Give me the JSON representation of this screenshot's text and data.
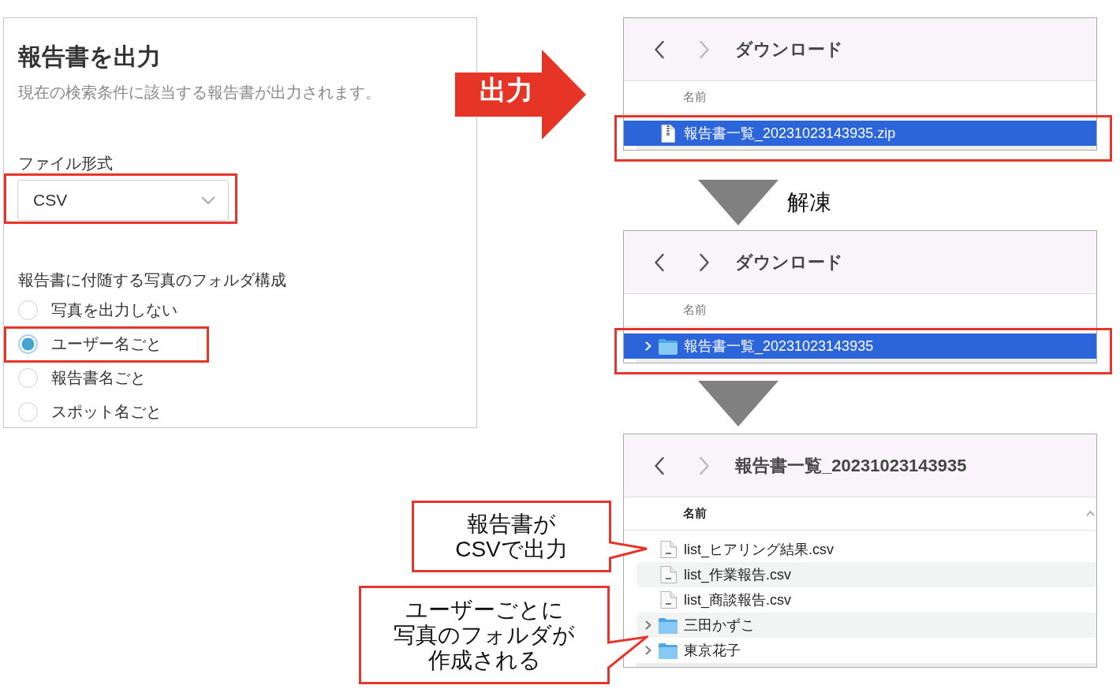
{
  "export_panel": {
    "title": "報告書を出力",
    "description": "現在の検索条件に該当する報告書が出力されます。",
    "file_format": {
      "label": "ファイル形式",
      "value": "CSV",
      "highlighted": true
    },
    "photo_folder": {
      "label": "報告書に付随する写真のフォルダ構成",
      "options": [
        {
          "label": "写真を出力しない",
          "selected": false,
          "highlighted": false
        },
        {
          "label": "ユーザー名ごと",
          "selected": true,
          "highlighted": true
        },
        {
          "label": "報告書名ごと",
          "selected": false,
          "highlighted": false
        },
        {
          "label": "スポット名ごと",
          "selected": false,
          "highlighted": false
        }
      ]
    }
  },
  "export_arrow": {
    "label": "出力"
  },
  "finder_windows": [
    {
      "title": "ダウンロード",
      "back_enabled": true,
      "forward_enabled": false,
      "column_header": "名前",
      "sorted": false,
      "rows": [
        {
          "kind": "zip",
          "name": "報告書一覧_20231023143935.zip",
          "selected": true,
          "highlighted": true
        }
      ]
    },
    {
      "step_label": "解凍",
      "title": "ダウンロード",
      "back_enabled": true,
      "forward_enabled": true,
      "column_header": "名前",
      "sorted": false,
      "rows": [
        {
          "kind": "folder",
          "name": "報告書一覧_20231023143935",
          "selected": true,
          "highlighted": true,
          "expanded": false
        }
      ]
    },
    {
      "title": "報告書一覧_20231023143935",
      "back_enabled": true,
      "forward_enabled": false,
      "column_header": "名前",
      "sorted": true,
      "rows": [
        {
          "kind": "csv",
          "name": "list_ヒアリング結果.csv",
          "selected": false,
          "highlighted": false
        },
        {
          "kind": "csv",
          "name": "list_作業報告.csv",
          "selected": false,
          "highlighted": false
        },
        {
          "kind": "csv",
          "name": "list_商談報告.csv",
          "selected": false,
          "highlighted": false
        },
        {
          "kind": "folder",
          "name": "三田かずこ",
          "selected": false,
          "highlighted": false,
          "expanded": false
        },
        {
          "kind": "folder",
          "name": "東京花子",
          "selected": false,
          "highlighted": false,
          "expanded": false
        }
      ]
    }
  ],
  "callouts": [
    {
      "lines": [
        "報告書が",
        "CSVで出力"
      ]
    },
    {
      "lines": [
        "ユーザーごとに",
        "写真のフォルダが",
        "作成される"
      ]
    }
  ]
}
